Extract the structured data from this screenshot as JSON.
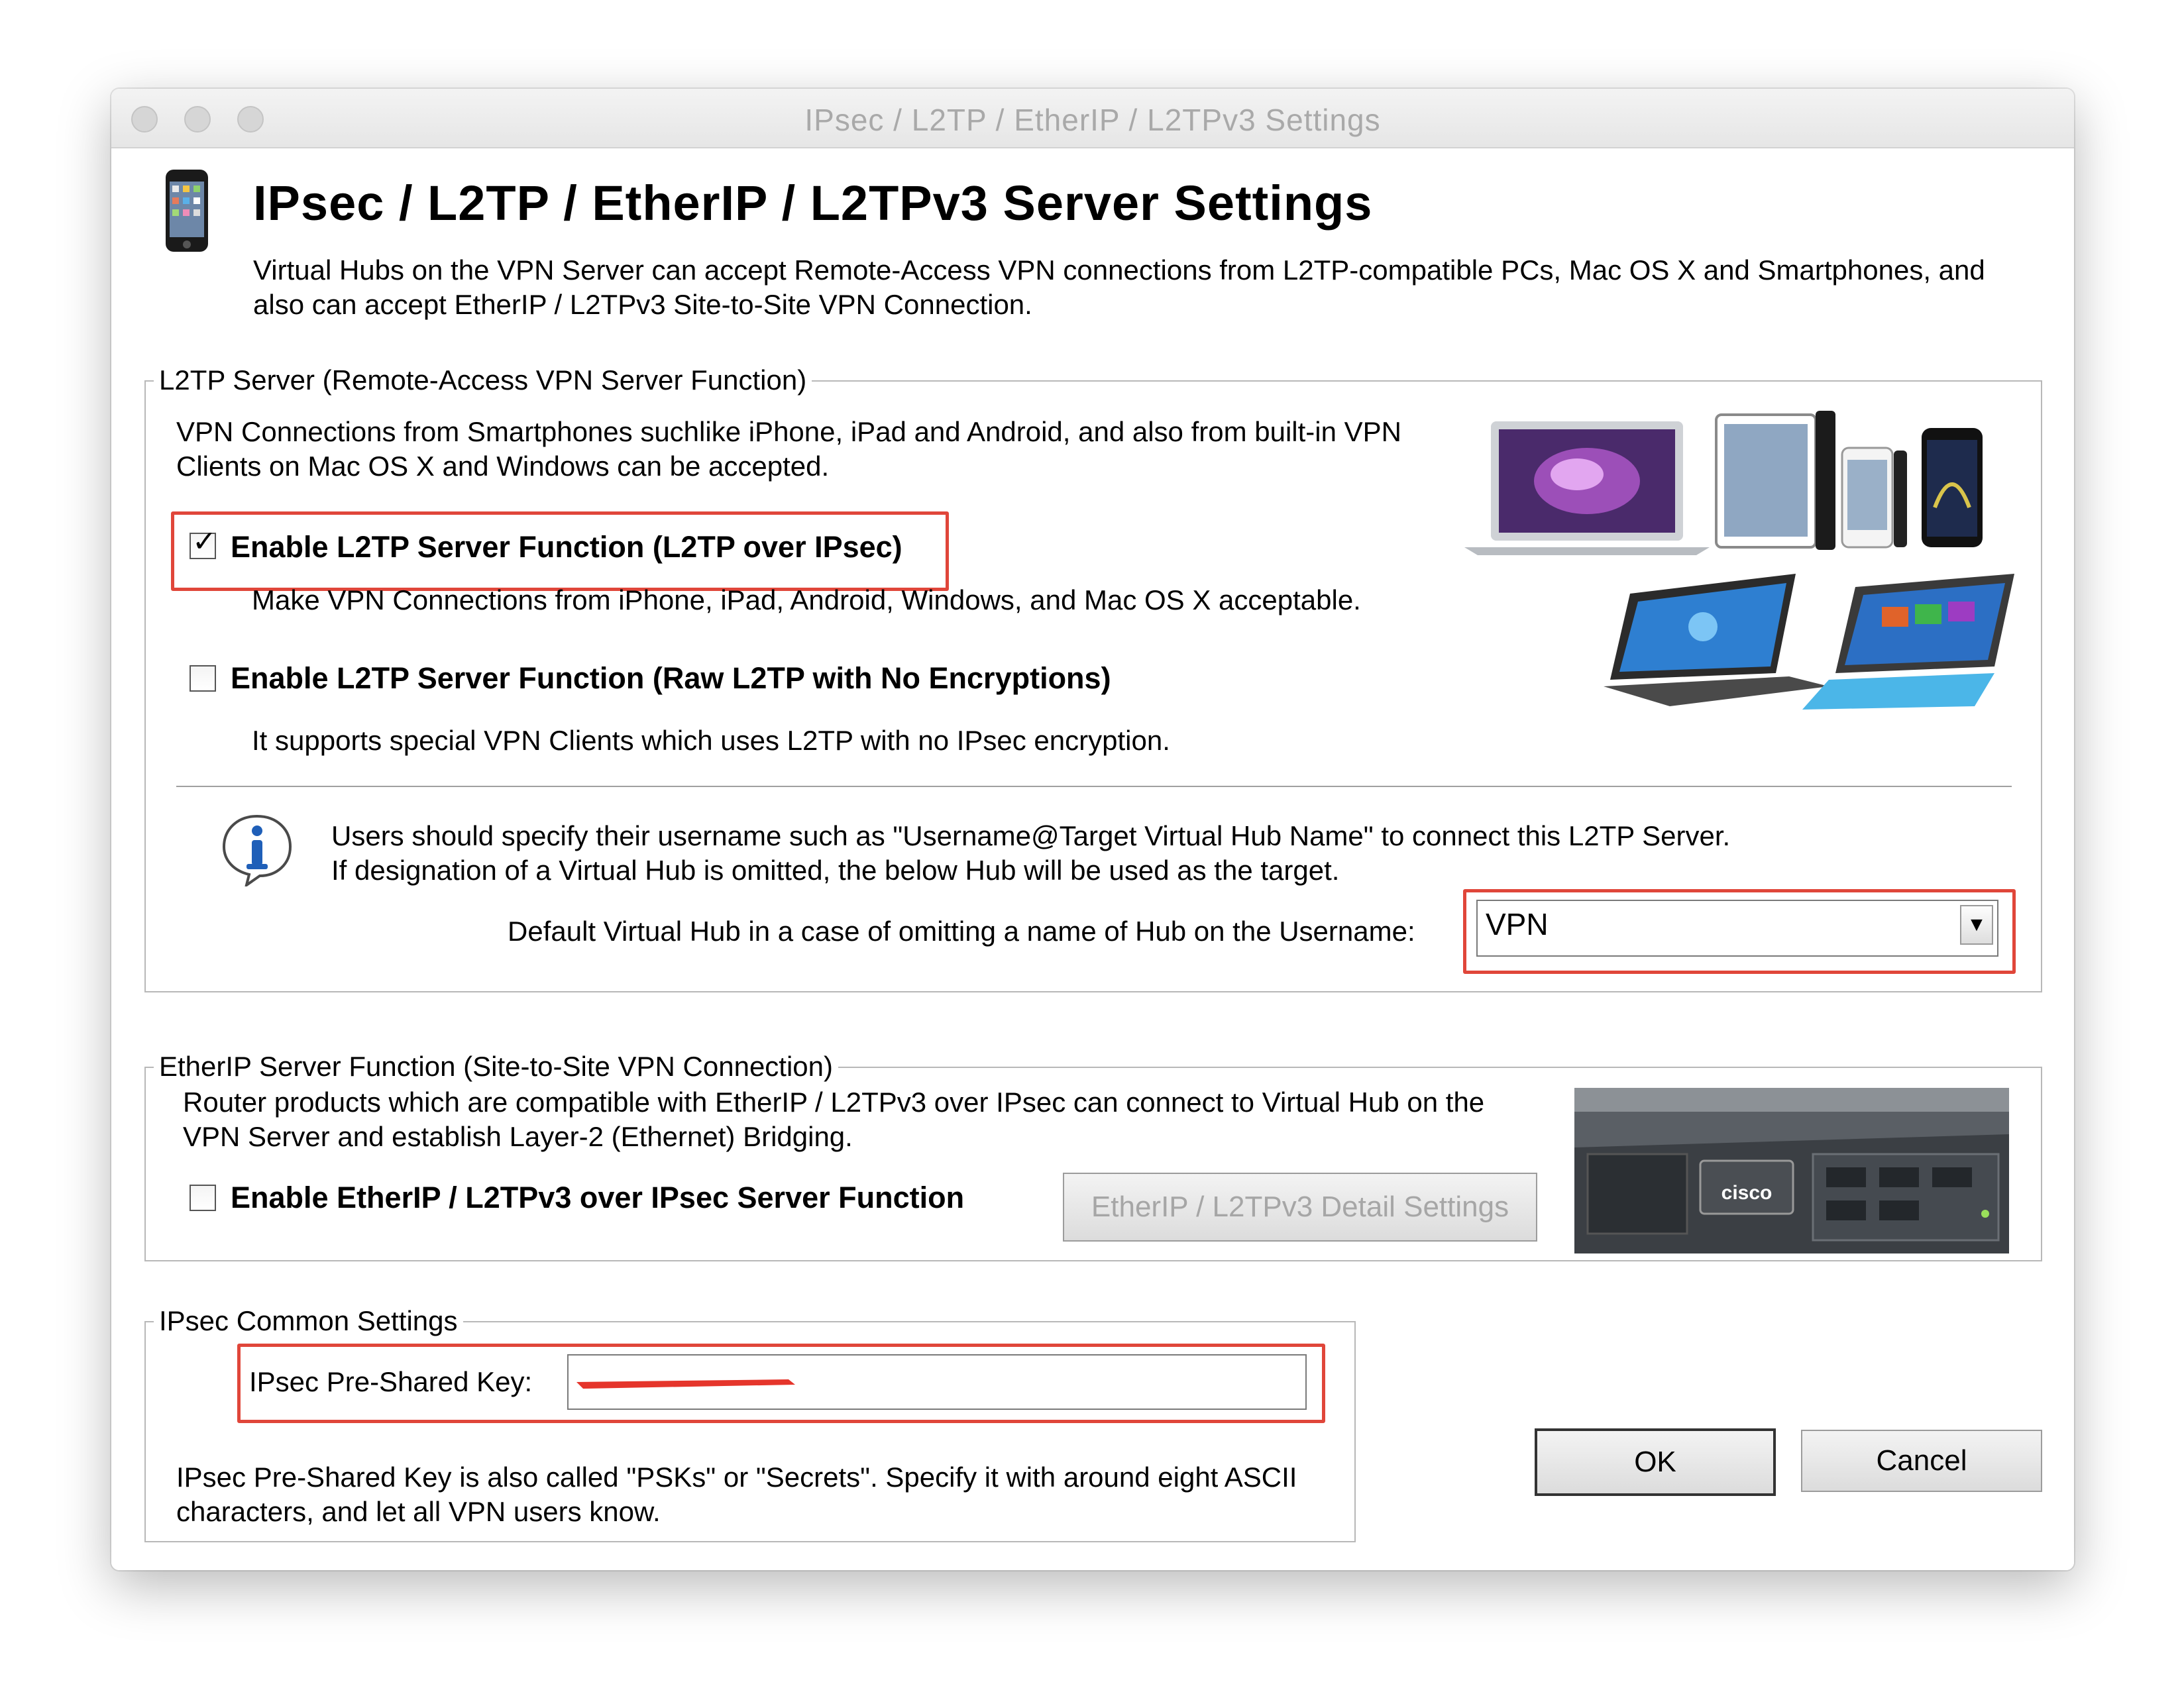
{
  "window": {
    "title": "IPsec / L2TP / EtherIP / L2TPv3 Settings"
  },
  "header": {
    "title": "IPsec / L2TP / EtherIP / L2TPv3 Server Settings",
    "desc_line1": "Virtual Hubs on the VPN Server can accept Remote-Access VPN connections from L2TP-compatible PCs, Mac OS X and Smartphones, and",
    "desc_line2": "also can accept EtherIP / L2TPv3 Site-to-Site VPN Connection."
  },
  "l2tp": {
    "legend": "L2TP Server (Remote-Access VPN Server Function)",
    "intro_line1": "VPN Connections from Smartphones suchlike iPhone, iPad and Android, and also from built-in VPN",
    "intro_line2": "Clients on Mac OS X and Windows can be accepted.",
    "ipsec_checkbox_label": "Enable L2TP Server Function (L2TP over IPsec)",
    "ipsec_checked": true,
    "ipsec_desc": "Make VPN Connections from iPhone, iPad, Android, Windows, and Mac OS X acceptable.",
    "raw_checkbox_label": "Enable L2TP Server Function (Raw L2TP with No Encryptions)",
    "raw_checked": false,
    "raw_desc": "It supports special VPN Clients which uses L2TP with no IPsec encryption.",
    "info_line1": "Users should specify their username such as \"Username@Target Virtual Hub Name\" to connect this L2TP Server.",
    "info_line2": "If designation of a Virtual Hub is omitted, the below Hub will be used as the target.",
    "default_hub_label": "Default Virtual Hub in a case of omitting a name of Hub on the Username:",
    "default_hub_value": "VPN"
  },
  "etherip": {
    "legend": "EtherIP Server Function (Site-to-Site VPN Connection)",
    "desc_line1": "Router products which are compatible with EtherIP / L2TPv3 over IPsec can connect to Virtual Hub on the",
    "desc_line2": "VPN Server and establish Layer-2 (Ethernet) Bridging.",
    "checkbox_label": "Enable EtherIP / L2TPv3 over IPsec Server Function",
    "checked": false,
    "detail_button": "EtherIP / L2TPv3 Detail Settings",
    "logo_text": "cisco"
  },
  "ipsec": {
    "legend": "IPsec Common Settings",
    "psk_label": "IPsec Pre-Shared Key:",
    "note_line1": "IPsec Pre-Shared Key is also called \"PSKs\" or \"Secrets\". Specify it with around eight ASCII",
    "note_line2": "characters, and let all VPN users know."
  },
  "buttons": {
    "ok": "OK",
    "cancel": "Cancel"
  },
  "colors": {
    "highlight": "#e0463a",
    "redaction": "#e5352b"
  }
}
